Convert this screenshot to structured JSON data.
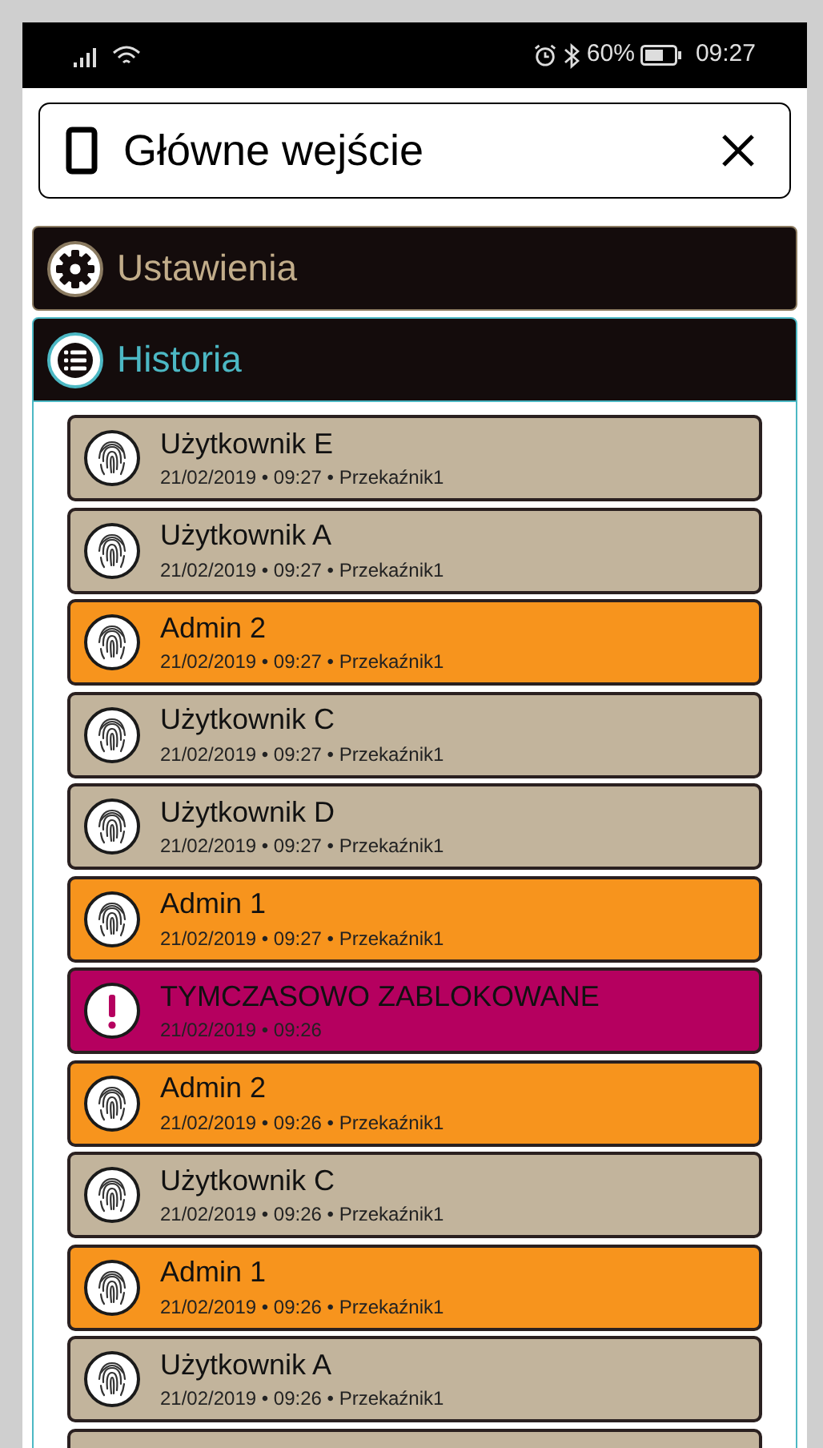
{
  "status_bar": {
    "battery": "60%",
    "time": "09:27"
  },
  "header": {
    "title": "Główne wejście"
  },
  "sections": [
    {
      "label": "Ustawienia",
      "kind": "settings",
      "expanded": false
    },
    {
      "label": "Historia",
      "kind": "history",
      "expanded": true
    }
  ],
  "history": [
    {
      "kind": "user",
      "color": "#c2b49c",
      "title": "Użytkownik E",
      "details": "21/02/2019 • 09:27 • Przekaźnik1"
    },
    {
      "kind": "user",
      "color": "#c2b49c",
      "title": "Użytkownik A",
      "details": "21/02/2019 • 09:27 • Przekaźnik1"
    },
    {
      "kind": "user",
      "color": "#f7941d",
      "title": "Admin 2",
      "details": "21/02/2019 • 09:27 • Przekaźnik1"
    },
    {
      "kind": "user",
      "color": "#c2b49c",
      "title": "Użytkownik C",
      "details": "21/02/2019 • 09:27 • Przekaźnik1"
    },
    {
      "kind": "user",
      "color": "#c2b49c",
      "title": "Użytkownik D",
      "details": "21/02/2019 • 09:27 • Przekaźnik1"
    },
    {
      "kind": "user",
      "color": "#f7941d",
      "title": "Admin 1",
      "details": "21/02/2019 • 09:27 • Przekaźnik1"
    },
    {
      "kind": "alert",
      "color": "#b5005f",
      "title": "TYMCZASOWO ZABLOKOWANE",
      "details": "21/02/2019 • 09:26"
    },
    {
      "kind": "user",
      "color": "#f7941d",
      "title": "Admin 2",
      "details": "21/02/2019 • 09:26 • Przekaźnik1"
    },
    {
      "kind": "user",
      "color": "#c2b49c",
      "title": "Użytkownik C",
      "details": "21/02/2019 • 09:26 • Przekaźnik1"
    },
    {
      "kind": "user",
      "color": "#f7941d",
      "title": "Admin 1",
      "details": "21/02/2019 • 09:26 • Przekaźnik1"
    },
    {
      "kind": "user",
      "color": "#c2b49c",
      "title": "Użytkownik A",
      "details": "21/02/2019 • 09:26 • Przekaźnik1"
    }
  ]
}
